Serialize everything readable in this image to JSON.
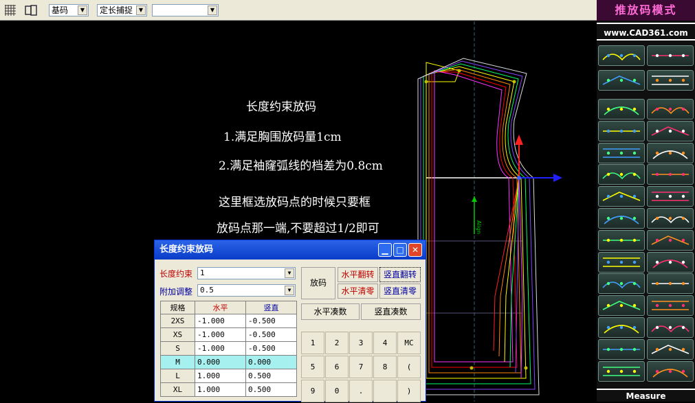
{
  "toolbar": {
    "base_size": "基码",
    "snap_mode": "定长捕捉",
    "empty_select": ""
  },
  "canvas": {
    "notes": [
      "长度约束放码",
      "1.满足胸围放码量1cm",
      "2.满足袖窿弧线的档差为0.8cm",
      "这里框选放码点的时候只要框",
      "放码点那一端,不要超过1/2即可"
    ],
    "axis_label": "Align"
  },
  "right_panel": {
    "mode_title": "推放码模式",
    "url": "www.CAD361.com",
    "buttons": [
      "grade-rule-button",
      "grade-table-button",
      "xy-grade-button",
      "copy-grade-button",
      "arc-point-button",
      "line-point-button",
      "horizontal-shift-button",
      "move-point-button",
      "dotted-line-button",
      "align-point-button",
      "curve-point-button",
      "arrow-point-button",
      "corner-copy-button",
      "scissor-button",
      "delete-point-button",
      "edit-point-button",
      "bend-grade-button",
      "close-grade-button",
      "horizontal-grade-button",
      "bracket-grade-button",
      "curve-dots-button",
      "curve-smooth-button",
      "fold-arrow-button",
      "wave-button",
      "xy-copy-button",
      "move-zoom-button",
      "xy-paste-button",
      "fill-transfer-button",
      "cut-curve-button",
      "erase-button"
    ],
    "measure": "Measure"
  },
  "dialog": {
    "title": "长度约束放码",
    "length_label": "长度约束",
    "length_value": "1",
    "adjust_label": "附加调整",
    "adjust_value": "0.5",
    "grade_button": "放码",
    "h_flip": "水平翻转",
    "v_flip": "竖直翻转",
    "h_clear": "水平清零",
    "v_clear": "竖直清零",
    "h_round": "水平凑数",
    "v_round": "竖直凑数",
    "table": {
      "headers": [
        "规格",
        "水平",
        "竖直"
      ],
      "rows": [
        [
          "2XS",
          "-1.000",
          "-0.500"
        ],
        [
          "XS",
          "-1.000",
          "-0.500"
        ],
        [
          "S",
          "-1.000",
          "-0.500"
        ],
        [
          "M",
          "0.000",
          "0.000"
        ],
        [
          "L",
          "1.000",
          "0.500"
        ],
        [
          "XL",
          "1.000",
          "0.500"
        ]
      ]
    },
    "keypad": [
      "1",
      "2",
      "3",
      "4",
      "MC",
      "5",
      "6",
      "7",
      "8",
      "(",
      "9",
      "0",
      ".",
      "",
      ")"
    ]
  }
}
